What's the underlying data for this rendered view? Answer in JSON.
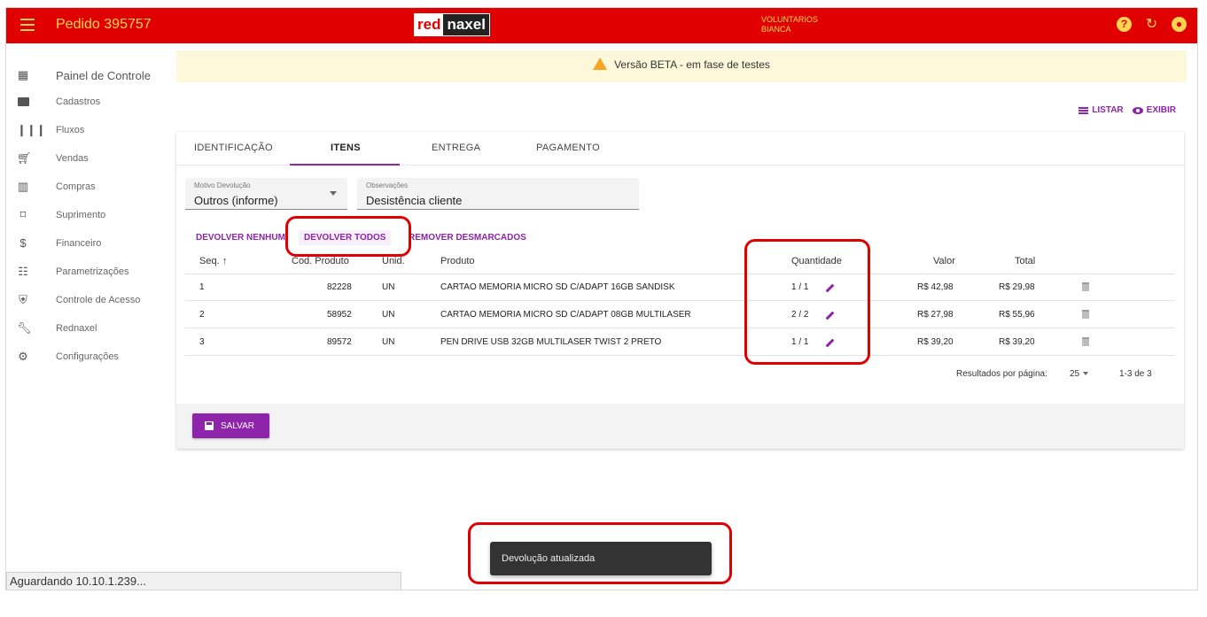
{
  "header": {
    "title": "Pedido 395757",
    "logo_red": "red",
    "logo_naxel": "naxel",
    "company": "VOLUNTARIOS",
    "user": "BIANCA"
  },
  "sidebar": {
    "items": [
      {
        "label": "Painel de Controle",
        "icon": "dashboard-icon"
      },
      {
        "label": "Cadastros",
        "icon": "folder-icon"
      },
      {
        "label": "Fluxos",
        "icon": "columns-icon"
      },
      {
        "label": "Vendas",
        "icon": "cart-icon"
      },
      {
        "label": "Compras",
        "icon": "building-icon"
      },
      {
        "label": "Suprimento",
        "icon": "crop-icon"
      },
      {
        "label": "Financeiro",
        "icon": "money-icon"
      },
      {
        "label": "Parametrizações",
        "icon": "sliders-icon"
      },
      {
        "label": "Controle de Acesso",
        "icon": "shield-icon"
      },
      {
        "label": "Rednaxel",
        "icon": "wrench-icon"
      },
      {
        "label": "Configurações",
        "icon": "gear-icon"
      }
    ]
  },
  "banner": {
    "text": "Versão BETA - em fase de testes"
  },
  "view": {
    "list_label": "LISTAR",
    "show_label": "EXIBIR"
  },
  "tabs": [
    "IDENTIFICAÇÃO",
    "ITENS",
    "ENTREGA",
    "PAGAMENTO"
  ],
  "form": {
    "motivo_label": "Motivo Devolução",
    "motivo_value": "Outros (informe)",
    "obs_label": "Observações",
    "obs_value": "Desistência cliente"
  },
  "actions": {
    "none": "DEVOLVER NENHUM",
    "all": "DEVOLVER TODOS",
    "remove": "REMOVER DESMARCADOS"
  },
  "table": {
    "headers": {
      "seq": "Seq.",
      "sort": "↑",
      "code": "Cod. Produto",
      "unit": "Unid.",
      "product": "Produto",
      "qty": "Quantidade",
      "value": "Valor",
      "total": "Total"
    },
    "rows": [
      {
        "seq": "1",
        "code": "82228",
        "unit": "UN",
        "product": "CARTAO MEMORIA MICRO SD C/ADAPT 16GB SANDISK",
        "qty": "1 / 1",
        "value": "R$ 42,98",
        "total": "R$ 29,98"
      },
      {
        "seq": "2",
        "code": "58952",
        "unit": "UN",
        "product": "CARTAO MEMORIA MICRO SD C/ADAPT 08GB MULTILASER",
        "qty": "2 / 2",
        "value": "R$ 27,98",
        "total": "R$ 55,96"
      },
      {
        "seq": "3",
        "code": "89572",
        "unit": "UN",
        "product": "PEN DRIVE USB 32GB MULTILASER TWIST 2 PRETO",
        "qty": "1 / 1",
        "value": "R$ 39,20",
        "total": "R$ 39,20"
      }
    ]
  },
  "pager": {
    "label": "Resultados por página:",
    "size": "25",
    "range": "1-3 de 3"
  },
  "save": {
    "label": "SALVAR"
  },
  "snackbar": {
    "text": "Devolução atualizada"
  },
  "status": {
    "text": "Aguardando 10.10.1.239..."
  },
  "colors": {
    "topbar": "#e00000",
    "accent": "#8e24aa",
    "title": "#ffd54f",
    "banner": "#fdf8d9"
  }
}
